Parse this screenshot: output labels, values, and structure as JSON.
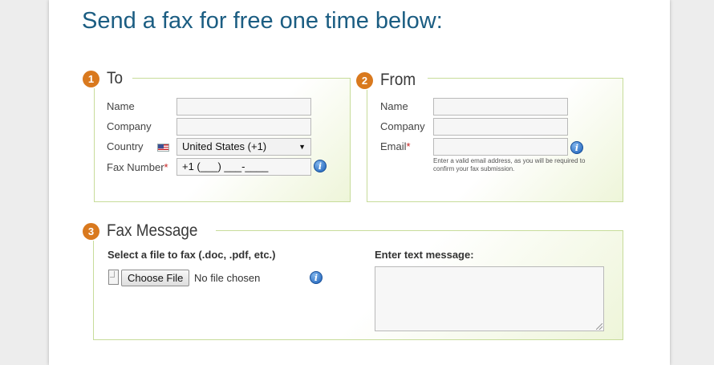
{
  "headline": "Send a fax for free one time below:",
  "colors": {
    "accent_orange": "#d9791e",
    "headline_blue": "#1b5d82",
    "panel_border": "#c7dc9a",
    "required_red": "#c62020"
  },
  "to": {
    "number": "1",
    "title": "To",
    "name_label": "Name",
    "company_label": "Company",
    "country_label": "Country",
    "country_flag_icon": "us-flag-icon",
    "country_value": "United States (+1)",
    "fax_label": "Fax Number",
    "required_mark": "*",
    "fax_value": "+1 (___) ___-____",
    "name_value": "",
    "company_value": ""
  },
  "from": {
    "number": "2",
    "title": "From",
    "name_label": "Name",
    "company_label": "Company",
    "email_label": "Email",
    "required_mark": "*",
    "email_hint": "Enter a valid email address, as you will be required to confirm your fax submission.",
    "name_value": "",
    "company_value": "",
    "email_value": ""
  },
  "message": {
    "number": "3",
    "title": "Fax Message",
    "file_label": "Select a file to fax (.doc, .pdf, etc.)",
    "choose_file_label": "Choose File",
    "no_file_text": "No file chosen",
    "text_label": "Enter text message:",
    "text_value": ""
  },
  "info_glyph": "i"
}
